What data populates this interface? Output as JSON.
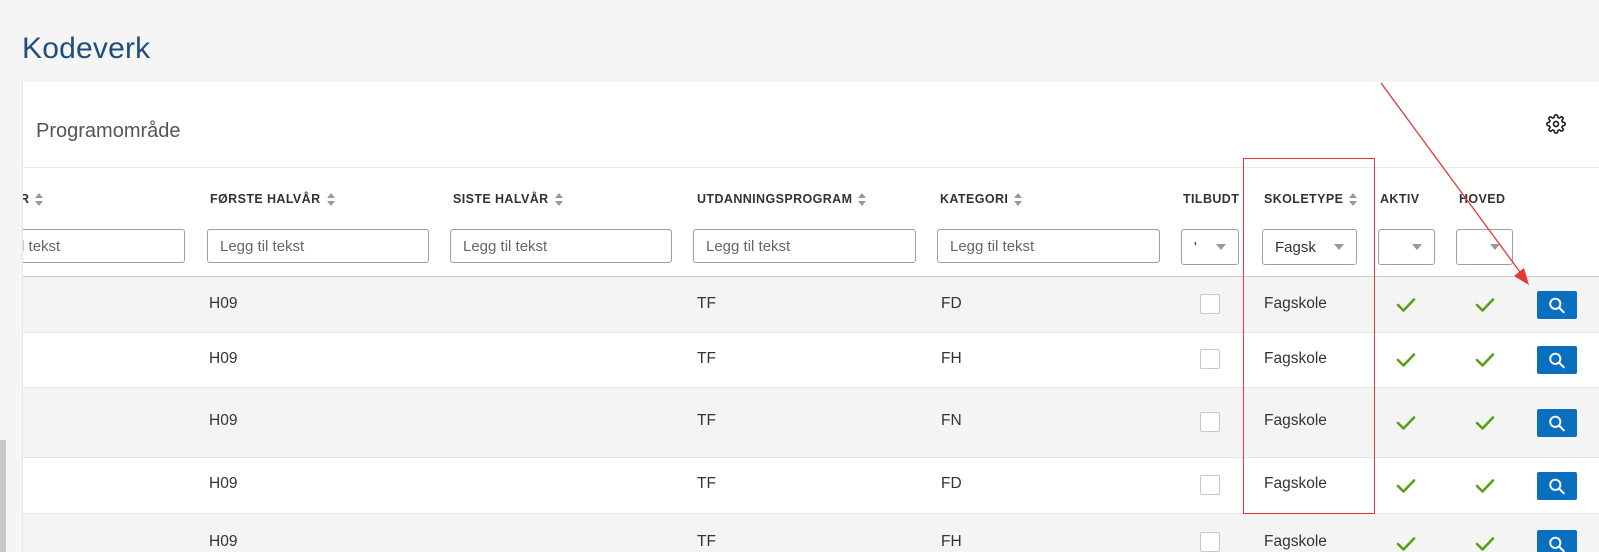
{
  "page": {
    "title": "Kodeverk"
  },
  "card": {
    "title": "Programområde"
  },
  "columns": {
    "col0": "R",
    "forste": "FØRSTE HALVÅR",
    "siste": "SISTE HALVÅR",
    "utdanning": "UTDANNINGSPROGRAM",
    "kategori": "KATEGORI",
    "tilbudt": "TILBUDT",
    "skoletype": "SKOLETYPE",
    "aktiv": "AKTIV",
    "hoved": "HOVED"
  },
  "filters": {
    "col0_placeholder": "Legg til tekst",
    "forste_placeholder": "Legg til tekst",
    "siste_placeholder": "Legg til tekst",
    "utdanning_placeholder": "Legg til tekst",
    "kategori_placeholder": "Legg til tekst",
    "tilbudt_value": "'",
    "skoletype_value": "Fagsk",
    "aktiv_value": "",
    "hoved_value": ""
  },
  "rows": [
    {
      "forste": "H09",
      "utdanning": "TF",
      "kategori": "FD",
      "tilbudt": false,
      "skoletype": "Fagskole",
      "aktiv": true,
      "hoved": true
    },
    {
      "forste": "H09",
      "utdanning": "TF",
      "kategori": "FH",
      "tilbudt": false,
      "skoletype": "Fagskole",
      "aktiv": true,
      "hoved": true
    },
    {
      "forste": "H09",
      "utdanning": "TF",
      "kategori": "FN",
      "tilbudt": false,
      "skoletype": "Fagskole",
      "aktiv": true,
      "hoved": true
    },
    {
      "forste": "H09",
      "utdanning": "TF",
      "kategori": "FD",
      "tilbudt": false,
      "skoletype": "Fagskole",
      "aktiv": true,
      "hoved": true
    },
    {
      "forste": "H09",
      "utdanning": "TF",
      "kategori": "FH",
      "tilbudt": false,
      "skoletype": "Fagskole",
      "aktiv": true,
      "hoved": true
    }
  ],
  "icons": {
    "settings": "gear-icon",
    "view": "search-icon",
    "check": "check-icon"
  },
  "colors": {
    "accent": "#0a6fbf",
    "check": "#5aa017",
    "annotation": "#e53935",
    "title": "#1f4e79"
  }
}
